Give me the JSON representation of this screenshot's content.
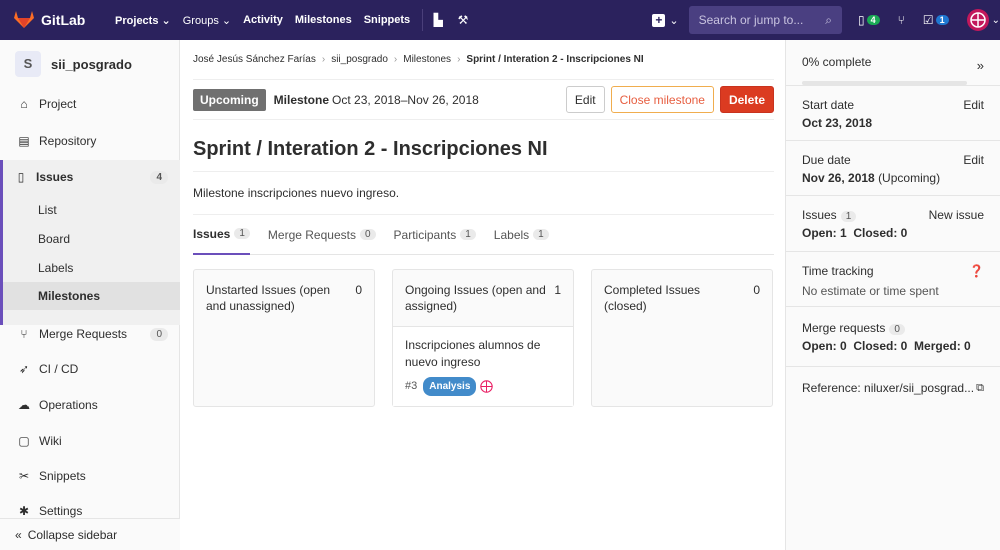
{
  "navbar": {
    "brand": "GitLab",
    "links": [
      "Projects",
      "Groups",
      "Activity",
      "Milestones",
      "Snippets"
    ],
    "search_placeholder": "Search or jump to...",
    "issues_count": "4",
    "todos_count": "1"
  },
  "sidebar": {
    "project_initial": "S",
    "project_name": "sii_posgrado",
    "items": {
      "project": "Project",
      "repository": "Repository",
      "issues": "Issues",
      "issues_count": "4",
      "merge_requests": "Merge Requests",
      "merge_requests_count": "0",
      "cicd": "CI / CD",
      "operations": "Operations",
      "wiki": "Wiki",
      "snippets": "Snippets",
      "settings": "Settings"
    },
    "issues_sub": [
      "List",
      "Board",
      "Labels",
      "Milestones"
    ],
    "collapse": "Collapse sidebar"
  },
  "breadcrumb": {
    "user": "José Jesús Sánchez Farías",
    "project": "sii_posgrado",
    "section": "Milestones",
    "current": "Sprint / Interation 2 - Inscripciones NI"
  },
  "milestone": {
    "status": "Upcoming",
    "label": "Milestone",
    "dates": "Oct 23, 2018–Nov 26, 2018",
    "edit": "Edit",
    "close": "Close milestone",
    "delete": "Delete",
    "title": "Sprint / Interation 2 - Inscripciones NI",
    "description": "Milestone inscripciones nuevo ingreso."
  },
  "tabs": [
    {
      "label": "Issues",
      "count": "1"
    },
    {
      "label": "Merge Requests",
      "count": "0"
    },
    {
      "label": "Participants",
      "count": "1"
    },
    {
      "label": "Labels",
      "count": "1"
    }
  ],
  "boards": {
    "unstarted": {
      "title": "Unstarted Issues (open and unassigned)",
      "count": "0"
    },
    "ongoing": {
      "title": "Ongoing Issues (open and assigned)",
      "count": "1"
    },
    "completed": {
      "title": "Completed Issues (closed)",
      "count": "0"
    },
    "card": {
      "title": "Inscripciones alumnos de nuevo ingreso",
      "ref": "#3",
      "label": "Analysis"
    }
  },
  "right": {
    "complete": "0% complete",
    "progress": 0,
    "start_label": "Start date",
    "start_value": "Oct 23, 2018",
    "due_label": "Due date",
    "due_value": "Nov 26, 2018",
    "due_status": "(Upcoming)",
    "edit": "Edit",
    "issues_label": "Issues",
    "issues_count": "1",
    "new_issue": "New issue",
    "issues_open": "Open: 1",
    "issues_closed": "Closed: 0",
    "time_label": "Time tracking",
    "time_value": "No estimate or time spent",
    "mr_label": "Merge requests",
    "mr_count": "0",
    "mr_open": "Open: 0",
    "mr_closed": "Closed: 0",
    "mr_merged": "Merged: 0",
    "reference": "Reference: niluxer/sii_posgrad..."
  },
  "colors": {
    "navbar": "#2b225d",
    "accent": "#6b4fbb",
    "delete": "#db3b21",
    "label_analysis": "#428bca"
  }
}
